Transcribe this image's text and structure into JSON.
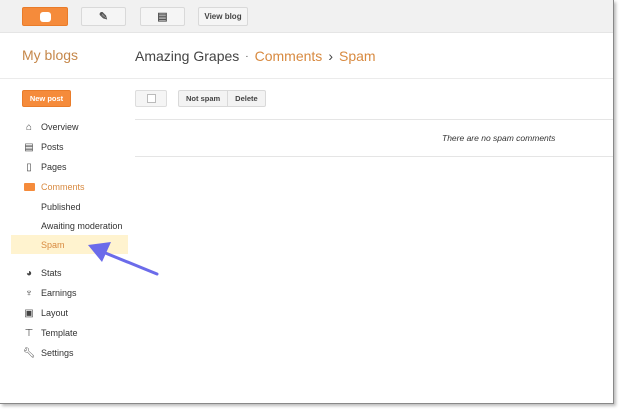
{
  "topbar": {
    "view_blog": "View blog"
  },
  "header": {
    "my_blogs": "My blogs",
    "blog_name": "Amazing Grapes",
    "separator": "·",
    "section": "Comments",
    "chevron": "›",
    "page": "Spam"
  },
  "sidebar": {
    "new_post": "New post",
    "items": [
      {
        "label": "Overview",
        "icon": "home-icon"
      },
      {
        "label": "Posts",
        "icon": "posts-icon"
      },
      {
        "label": "Pages",
        "icon": "page-icon"
      },
      {
        "label": "Comments",
        "icon": "comment-icon"
      }
    ],
    "sub": [
      "Published",
      "Awaiting moderation",
      "Spam"
    ],
    "items2": [
      {
        "label": "Stats",
        "icon": "pie-chart-icon"
      },
      {
        "label": "Earnings",
        "icon": "trophy-icon"
      },
      {
        "label": "Layout",
        "icon": "layout-icon"
      },
      {
        "label": "Template",
        "icon": "paint-roller-icon"
      },
      {
        "label": "Settings",
        "icon": "wrench-icon"
      }
    ]
  },
  "toolbar": {
    "not_spam": "Not spam",
    "delete": "Delete"
  },
  "main": {
    "empty": "There are no spam comments"
  },
  "colors": {
    "accent": "#f58b3b",
    "selected_bg": "#fff3cf",
    "arrow": "#6b6bea"
  }
}
